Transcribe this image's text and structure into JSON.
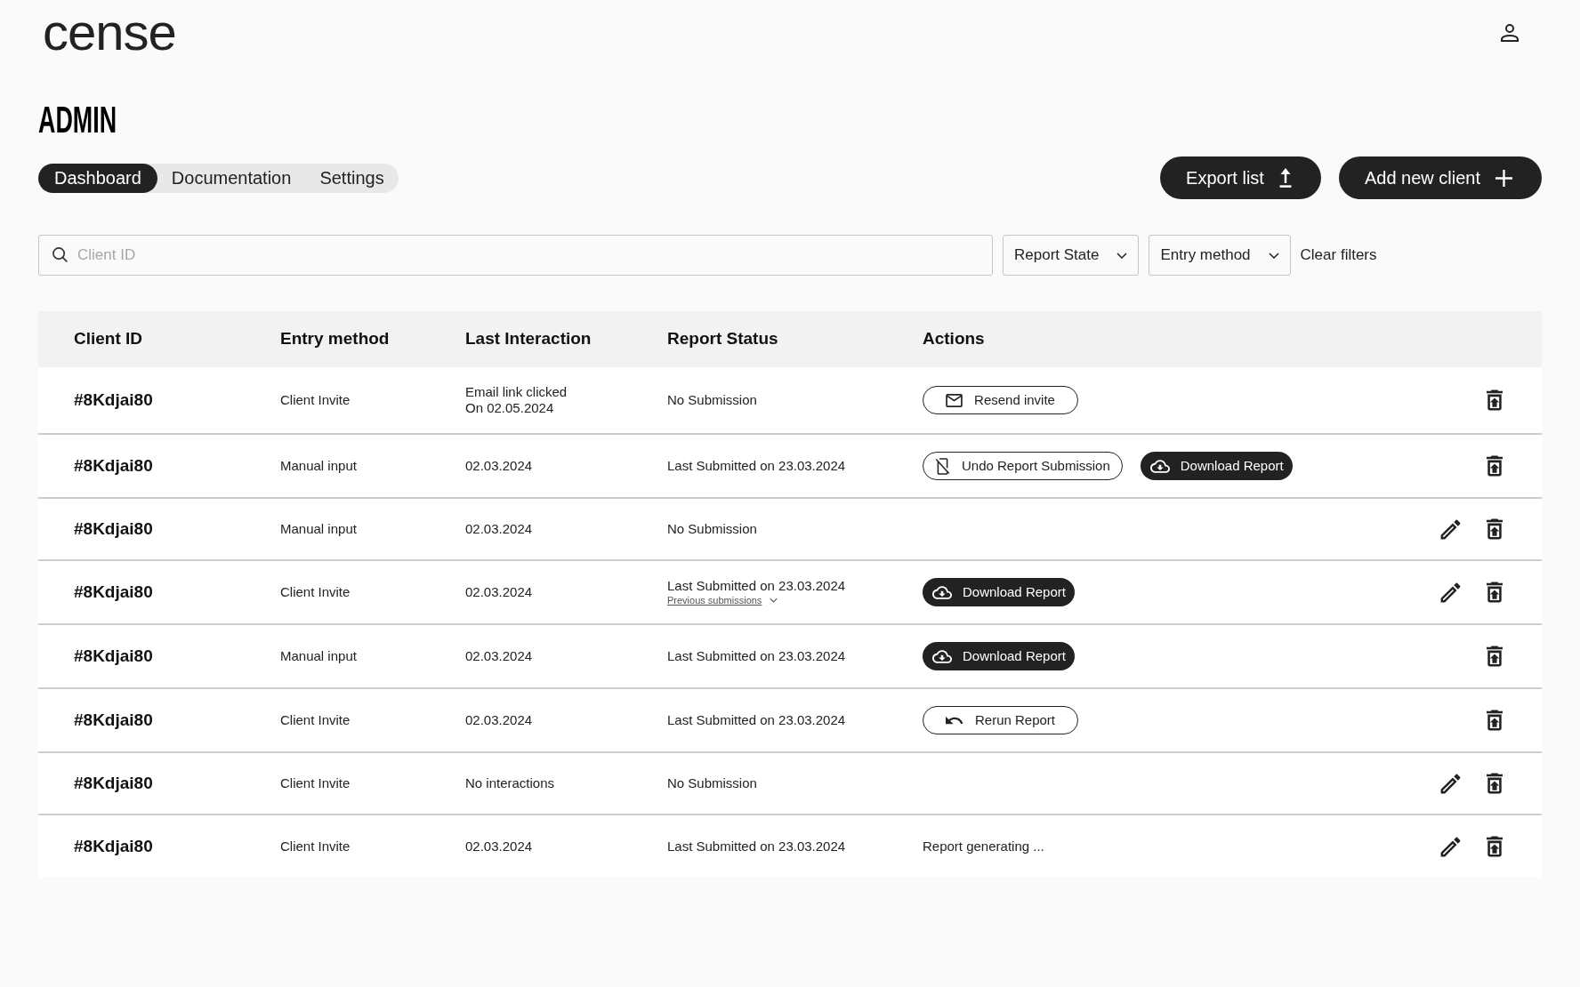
{
  "header": {
    "logo": "cense"
  },
  "page_title": "ADMIN",
  "tabs": [
    {
      "label": "Dashboard",
      "selected": true
    },
    {
      "label": "Documentation",
      "selected": false
    },
    {
      "label": "Settings",
      "selected": false
    }
  ],
  "page_actions": [
    {
      "kind": "export",
      "label": "Export list"
    },
    {
      "kind": "add",
      "label": "Add new client"
    }
  ],
  "filters": {
    "search": {
      "placeholder": "Client ID"
    },
    "dropdowns": [
      {
        "label": "Report State"
      },
      {
        "label": "Entry method"
      }
    ],
    "clear_label": "Clear filters"
  },
  "table": {
    "columns": [
      "Client ID",
      "Entry method",
      "Last Interaction",
      "Report Status",
      "Actions"
    ],
    "rows": [
      {
        "client_id": "#8Kdjai80",
        "entry_method": "Client Invite",
        "last_interaction": "Email link clicked\nOn 02.05.2024",
        "report_status": "No Submission",
        "actions": [
          {
            "kind": "resend",
            "label": "Resend invite"
          }
        ],
        "editable": false
      },
      {
        "client_id": "#8Kdjai80",
        "entry_method": "Manual input",
        "last_interaction": "02.03.2024",
        "report_status": "Last Submitted on 23.03.2024",
        "actions": [
          {
            "kind": "undo",
            "label": "Undo Report Submission"
          },
          {
            "kind": "download",
            "label": "Download Report"
          }
        ],
        "editable": false
      },
      {
        "client_id": "#8Kdjai80",
        "entry_method": "Manual input",
        "last_interaction": "02.03.2024",
        "report_status": "No Submission",
        "editable": true
      },
      {
        "client_id": "#8Kdjai80",
        "entry_method": "Client Invite",
        "last_interaction": "02.03.2024",
        "report_status": "Last Submitted on 23.03.2024",
        "previous_submissions": "Previous submissions",
        "actions": [
          {
            "kind": "download",
            "label": "Download Report"
          }
        ],
        "editable": true
      },
      {
        "client_id": "#8Kdjai80",
        "entry_method": "Manual input",
        "last_interaction": "02.03.2024",
        "report_status": "Last Submitted on 23.03.2024",
        "actions": [
          {
            "kind": "download",
            "label": "Download Report"
          }
        ],
        "editable": false
      },
      {
        "client_id": "#8Kdjai80",
        "entry_method": "Client Invite",
        "last_interaction": "02.03.2024",
        "report_status": "Last Submitted on 23.03.2024",
        "actions": [
          {
            "kind": "rerun",
            "label": "Rerun Report"
          }
        ],
        "editable": false
      },
      {
        "client_id": "#8Kdjai80",
        "entry_method": "Client Invite",
        "last_interaction": "No interactions",
        "report_status": "No Submission",
        "editable": true
      },
      {
        "client_id": "#8Kdjai80",
        "entry_method": "Client Invite",
        "last_interaction": "02.03.2024",
        "report_status": "Last Submitted on 23.03.2024",
        "actions": [
          {
            "kind": "note",
            "label": "Report generating ..."
          }
        ],
        "editable": true
      }
    ]
  }
}
